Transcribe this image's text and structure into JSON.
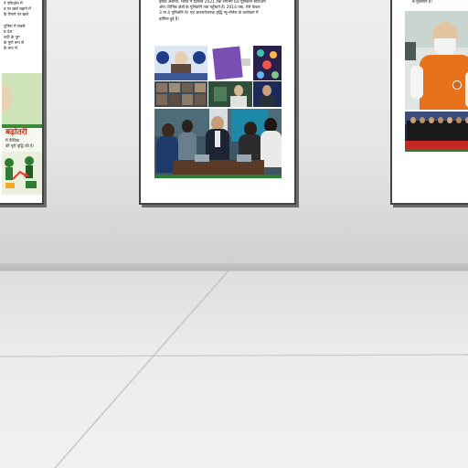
{
  "scene": {
    "left_panel": {
      "lines": [
        "ने परिवर्तन में",
        "ड पर खर्च बढ़ाने में",
        "के पैमाने पर खर्च",
        "दुनिया में सबसे",
        "घ्र देश",
        "शदी के युग",
        "के पूर्ण रूप से",
        "के रूप में"
      ],
      "heading": "बढ़ोतरी",
      "caption": [
        "में वैश्विक",
        "की पूरी वृद्धि की है।"
      ]
    },
    "center_panel": {
      "lines": [
        "इसके अलावा, भारत में दिसंबर 2021 तक लगभग 60 यूनिकॉर्न स्टार्टअप",
        "ओर। विभिन्न क्षेत्रों के यूनिकॉर्न तक पहुँचाते हैं। 2014 तक, ऐसे केवल",
        "3 या 4 यूनिकॉर्न थे। यह आश्चर्यजनक वृद्धि न्यू-नोर्मल के कार्यक्रम में",
        "हासिल हुई है।"
      ]
    },
    "right_panel": {
      "lines": [
        "र्ब-नुकसान है।"
      ]
    }
  }
}
